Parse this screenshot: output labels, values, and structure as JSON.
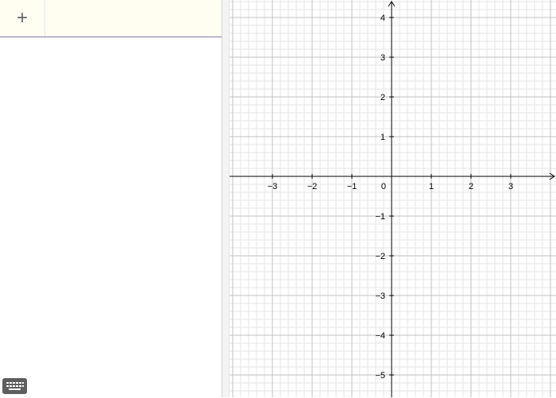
{
  "algebra_view": {
    "add_icon": "plus-icon",
    "input_value": "",
    "keyboard_icon": "keyboard-icon"
  },
  "graphics_view": {
    "x_ticks": [
      "−3",
      "−2",
      "−1",
      "0",
      "1",
      "2",
      "3"
    ],
    "y_ticks": [
      "4",
      "3",
      "2",
      "1",
      "−1",
      "−2",
      "−3",
      "−4",
      "−5"
    ],
    "grid": true,
    "axis_color": "#000000",
    "major_grid_color": "#c0c0c0",
    "minor_grid_color": "#e6e6e6"
  }
}
